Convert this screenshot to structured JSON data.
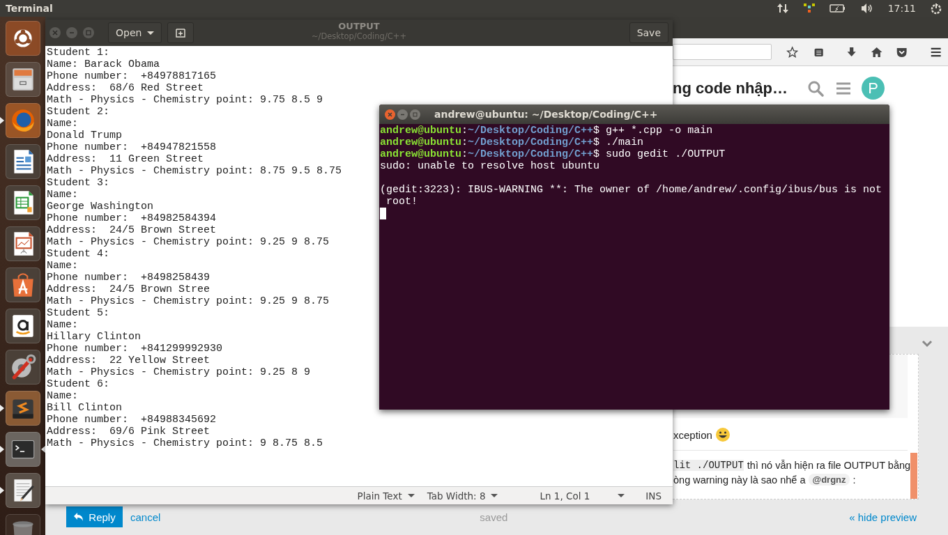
{
  "top_panel": {
    "app_title": "Terminal",
    "clock": "17:11"
  },
  "launcher": {
    "items": [
      {
        "kind": "ubuntu",
        "running": false,
        "focused": false
      },
      {
        "kind": "files",
        "running": false,
        "focused": false
      },
      {
        "kind": "firefox",
        "running": true,
        "focused": false
      },
      {
        "kind": "writer",
        "running": false,
        "focused": false
      },
      {
        "kind": "calc",
        "running": false,
        "focused": false
      },
      {
        "kind": "impress",
        "running": false,
        "focused": false
      },
      {
        "kind": "software",
        "running": false,
        "focused": false
      },
      {
        "kind": "amazon",
        "running": false,
        "focused": false
      },
      {
        "kind": "settings",
        "running": false,
        "focused": false
      },
      {
        "kind": "sublime",
        "running": true,
        "focused": false
      },
      {
        "kind": "terminal",
        "running": true,
        "focused": true
      },
      {
        "kind": "texteditor",
        "running": true,
        "focused": false
      },
      {
        "kind": "trash",
        "running": false,
        "focused": false
      }
    ]
  },
  "browser": {
    "page_title": "ng code nhập…",
    "avatar": "P",
    "preview": {
      "line_1": "xception",
      "lines": [
        {
          "segments": [
            {
              "kind": "code",
              "text": "lit ./OUTPUT"
            },
            {
              "kind": "text",
              "text": "thì nó vẫn hiện ra file OUTPUT bằng"
            }
          ]
        },
        {
          "segments": [
            {
              "kind": "text",
              "text": "òng warning này là sao nhể a"
            },
            {
              "kind": "mention",
              "text": "@drgnz"
            },
            {
              "kind": "text",
              "text": ":"
            }
          ]
        }
      ]
    },
    "reply_button": "Reply",
    "cancel": "cancel",
    "status": "saved",
    "hide_preview": "« hide preview"
  },
  "editor": {
    "title": "OUTPUT",
    "subtitle": "~/Desktop/Coding/C++",
    "open_button": "Open",
    "save_button": "Save",
    "lines": [
      "Student 1:",
      "Name: Barack Obama",
      "Phone number:  +84978817165",
      "Address:  68/6 Red Street",
      "Math - Physics - Chemistry point: 9.75 8.5 9",
      "Student 2:",
      "Name:",
      "Donald Trump",
      "Phone number:  +84947821558",
      "Address:  11 Green Street",
      "Math - Physics - Chemistry point: 8.75 9.5 8.75",
      "Student 3:",
      "Name:",
      "George Washington",
      "Phone number:  +84982584394",
      "Address:  24/5 Brown Street",
      "Math - Physics - Chemistry point: 9.25 9 8.75",
      "Student 4:",
      "Name:",
      "Phone number:  +8498258439",
      "Address:  24/5 Brown Stree",
      "Math - Physics - Chemistry point: 9.25 9 8.75",
      "Student 5:",
      "Name:",
      "Hillary Clinton",
      "Phone number:  +841299992930",
      "Address:  22 Yellow Street",
      "Math - Physics - Chemistry point: 9.25 8 9",
      "Student 6:",
      "Name:",
      "Bill Clinton",
      "Phone number:  +84988345692",
      "Address:  69/6 Pink Street",
      "Math - Physics - Chemistry point: 9 8.75 8.5"
    ],
    "status_bar": {
      "language": "Plain Text",
      "tab_width": "Tab Width: 8",
      "position": "Ln 1, Col 1",
      "mode": "INS"
    }
  },
  "terminal": {
    "title": "andrew@ubuntu: ~/Desktop/Coding/C++",
    "lines": [
      {
        "kind": "prompt",
        "user": "andrew@ubuntu",
        "sep": ":",
        "path": "~/Desktop/Coding/C++",
        "symbol": "$",
        "command": "g++ *.cpp -o main"
      },
      {
        "kind": "prompt",
        "user": "andrew@ubuntu",
        "sep": ":",
        "path": "~/Desktop/Coding/C++",
        "symbol": "$",
        "command": "./main"
      },
      {
        "kind": "prompt",
        "user": "andrew@ubuntu",
        "sep": ":",
        "path": "~/Desktop/Coding/C++",
        "symbol": "$",
        "command": "sudo gedit ./OUTPUT"
      },
      {
        "kind": "output",
        "text": "sudo: unable to resolve host ubuntu"
      },
      {
        "kind": "blank"
      },
      {
        "kind": "output",
        "text": "(gedit:3223): IBUS-WARNING **: The owner of /home/andrew/.config/ibus/bus is not"
      },
      {
        "kind": "output",
        "text": " root!"
      },
      {
        "kind": "cursor"
      }
    ]
  }
}
